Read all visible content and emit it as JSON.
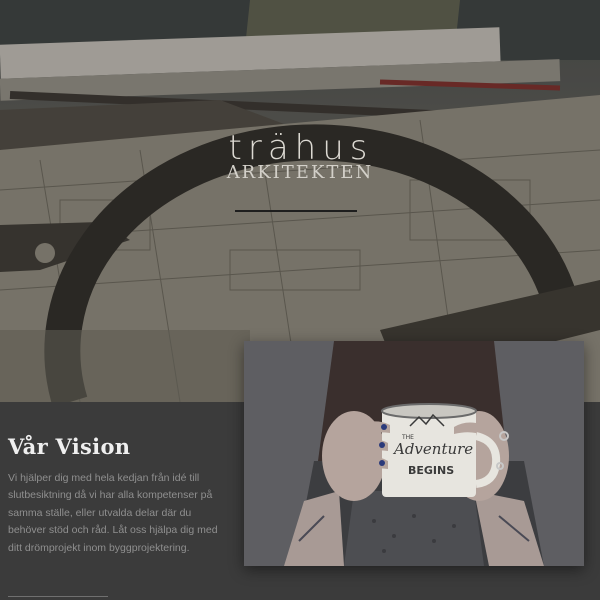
{
  "brand": {
    "name": "trähus",
    "subtitle": "ARKITEKTEN"
  },
  "vision": {
    "title": "Vår Vision",
    "text": "Vi hjälper dig med hela kedjan från idé till slutbesiktning då vi har alla kompetenser på samma ställe, eller utvalda delar där du behöver stöd och råd. Låt oss hjälpa dig med ditt drömprojekt inom byggprojektering."
  },
  "mug": {
    "line1": "THE",
    "line2": "Adventure",
    "line3": "BEGINS"
  },
  "colors": {
    "background": "#3b3b3b",
    "title": "#efefef",
    "body_text": "#8f8f8f"
  }
}
